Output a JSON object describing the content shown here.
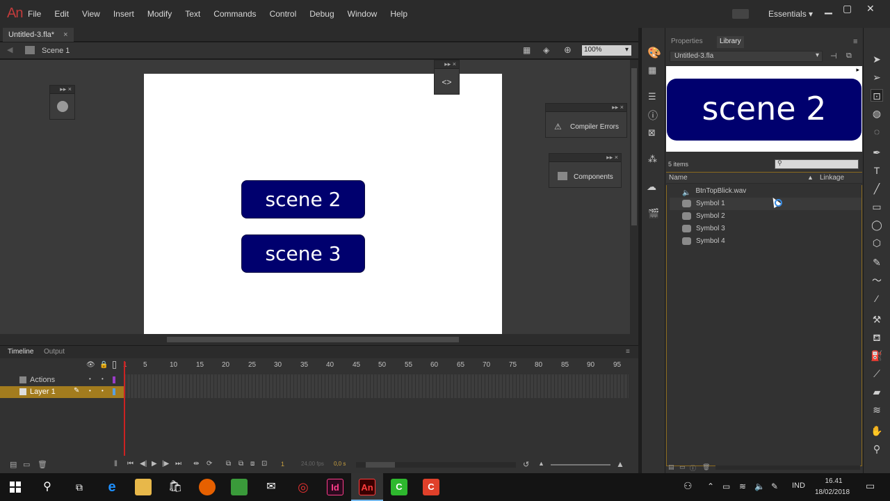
{
  "app": {
    "logo": "An",
    "menu": [
      "File",
      "Edit",
      "View",
      "Insert",
      "Modify",
      "Text",
      "Commands",
      "Control",
      "Debug",
      "Window",
      "Help"
    ],
    "workspace": "Essentials"
  },
  "document": {
    "tab_label": "Untitled-3.fla*",
    "scene_label": "Scene 1",
    "zoom": "100%"
  },
  "stage": {
    "buttons": [
      "scene 2",
      "scene 3"
    ]
  },
  "floating_panels": {
    "compiler_errors": "Compiler Errors",
    "components": "Components"
  },
  "timeline": {
    "tabs": [
      "Timeline",
      "Output"
    ],
    "ruler": [
      "1",
      "5",
      "10",
      "15",
      "20",
      "25",
      "30",
      "35",
      "40",
      "45",
      "50",
      "55",
      "60",
      "65",
      "70",
      "75",
      "80",
      "85",
      "90",
      "95"
    ],
    "layers": [
      "Actions",
      "Layer 1"
    ],
    "current_frame": "1",
    "fps": "24,00 fps",
    "elapsed": "0,0 s"
  },
  "library": {
    "tabs": [
      "Properties",
      "Library"
    ],
    "active_tab": "Library",
    "document": "Untitled-3.fla",
    "preview_text": "scene 2",
    "count": "5 items",
    "columns": [
      "Name",
      "Linkage"
    ],
    "items": [
      {
        "name": "BtnTopBlick.wav",
        "icon": "sound-icon"
      },
      {
        "name": "Symbol 1",
        "icon": "button-symbol-icon"
      },
      {
        "name": "Symbol 2",
        "icon": "button-symbol-icon"
      },
      {
        "name": "Symbol 3",
        "icon": "button-symbol-icon"
      },
      {
        "name": "Symbol 4",
        "icon": "button-symbol-icon"
      }
    ]
  },
  "taskbar": {
    "language": "IND",
    "time": "16.41",
    "date": "18/02/2018"
  },
  "colors": {
    "symbol_fill": "#00006e",
    "accent": "#8a6a1e",
    "playhead": "#cc2222"
  }
}
